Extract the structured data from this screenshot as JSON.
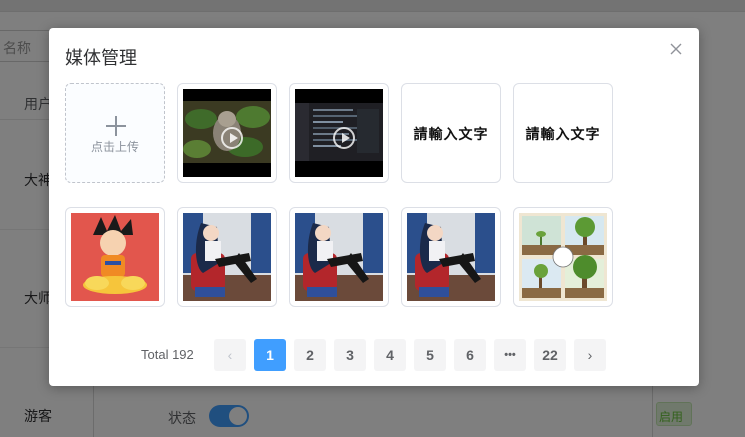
{
  "background": {
    "search_placeholder": "名称",
    "table_header": "用户",
    "rows": [
      "大神",
      "大师",
      "游客"
    ],
    "status_label": "状态",
    "status_tag": "启用"
  },
  "dialog": {
    "title": "媒体管理",
    "upload_label": "点击上传",
    "text_tile_label": "請輸入文字",
    "video_tiles": 2,
    "text_tiles": 2,
    "image_tiles": 5
  },
  "pagination": {
    "total_text": "Total 192",
    "prev": "‹",
    "next": "›",
    "pages": [
      "1",
      "2",
      "3",
      "4",
      "5",
      "6",
      "•••",
      "22"
    ],
    "current": "1"
  },
  "colors": {
    "primary": "#409eff",
    "overlay": "rgba(0,0,0,0.5)",
    "success_tag": "#67c23a"
  },
  "icons": {
    "close": "close-icon",
    "upload": "plus-icon",
    "play": "play-icon"
  }
}
